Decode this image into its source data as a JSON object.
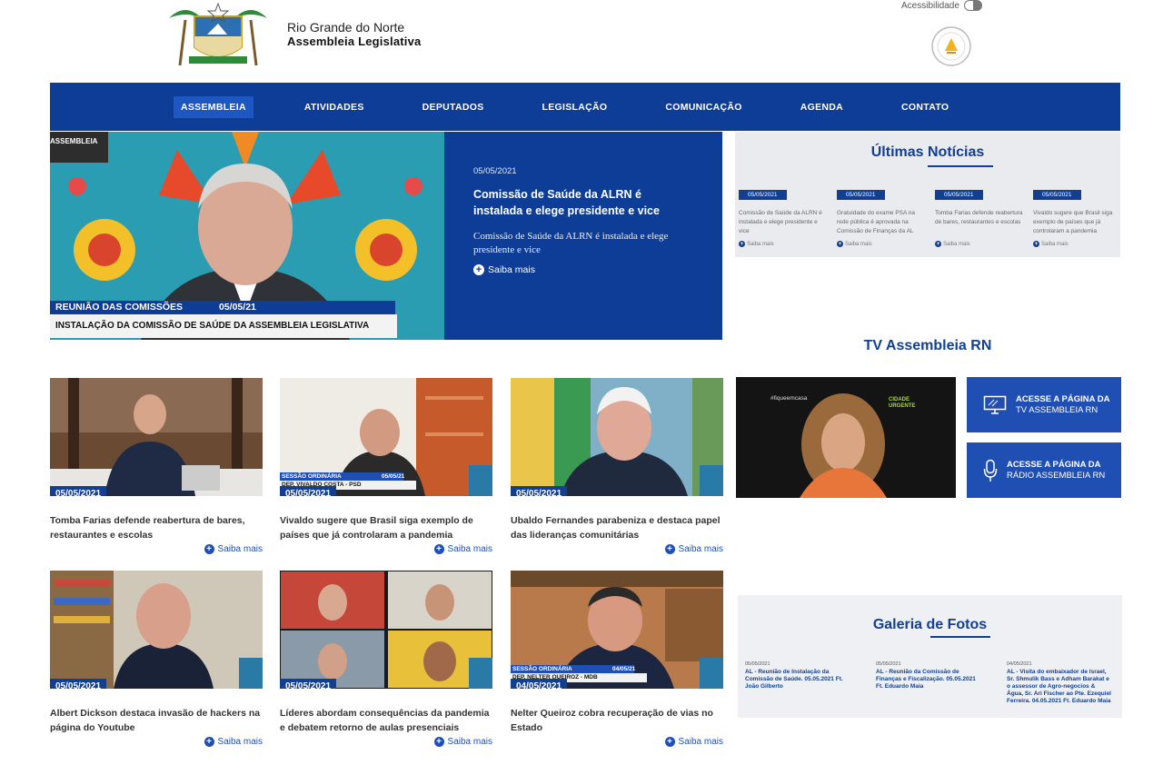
{
  "header": {
    "brand_line1": "Rio Grande do Norte",
    "brand_line2": "Assembleia Legislativa",
    "accessibility_label": "Acessibilidade"
  },
  "nav": {
    "items": [
      "ASSEMBLEIA",
      "ATIVIDADES",
      "DEPUTADOS",
      "LEGISLAÇÃO",
      "COMUNICAÇÃO",
      "AGENDA",
      "CONTATO"
    ],
    "active": "ASSEMBLEIA"
  },
  "hero": {
    "tag": "ASSEMBLEIA",
    "lower_third_label": "REUNIÃO DAS COMISSÕES",
    "lower_third_date": "05/05/21",
    "lower_third_title": "INSTALAÇÃO DA COMISSÃO DE SAÚDE DA ASSEMBLEIA LEGISLATIVA",
    "date": "05/05/2021",
    "title": "Comissão de Saúde da ALRN é instalada e elege presidente e vice",
    "summary": "Comissão de Saúde da ALRN é instalada e elege presidente e vice",
    "more": "Saiba mais"
  },
  "latest": {
    "heading": "Últimas Notícias",
    "items": [
      {
        "date": "05/05/2021",
        "title": "Comissão de Saúde da ALRN é instalada e elege presidente e vice",
        "more": "Saiba mais"
      },
      {
        "date": "05/05/2021",
        "title": "Gratuidade do exame PSA na rede pública é aprovada na Comissão de Finanças da AL",
        "more": "Saiba mais"
      },
      {
        "date": "05/05/2021",
        "title": "Tomba Farias defende reabertura de bares, restaurantes e escolas",
        "more": "Saiba mais"
      },
      {
        "date": "05/05/2021",
        "title": "Vivaldo sugere que Brasil siga exemplo de países que já controlaram a pandemia",
        "more": "Saiba mais"
      }
    ]
  },
  "tv": {
    "heading": "TV Assembleia RN",
    "video_hashtag": "#fiqueemcasa",
    "video_badge": "CIDADE URGENTE",
    "button_tv_line1": "ACESSE A PÁGINA DA",
    "button_tv_line2": "TV ASSEMBLEIA RN",
    "button_radio_line1": "ACESSE A PÁGINA DA",
    "button_radio_line2": "RÁDIO ASSEMBLEIA RN"
  },
  "news": [
    {
      "date": "05/05/2021",
      "title": "Tomba Farias defende reabertura de bares, restaurantes e escolas",
      "more": "Saiba mais"
    },
    {
      "date": "05/05/2021",
      "title": "Vivaldo sugere que Brasil siga exemplo de países que já controlaram a pandemia",
      "more": "Saiba mais",
      "overlay_label": "SESSÃO ORDINÁRIA",
      "overlay_date": "05/05/21",
      "overlay_name": "DEP. VIVALDO COSTA - PSD"
    },
    {
      "date": "05/05/2021",
      "title": "Ubaldo Fernandes parabeniza e destaca papel das lideranças comunitárias",
      "more": "Saiba mais"
    },
    {
      "date": "05/05/2021",
      "title": "Albert Dickson destaca invasão de hackers na página do Youtube",
      "more": "Saiba mais"
    },
    {
      "date": "05/05/2021",
      "title": "Líderes abordam consequências da pandemia e debatem retorno de aulas presenciais",
      "more": "Saiba mais"
    },
    {
      "date": "04/05/2021",
      "title": "Nelter Queiroz cobra recuperação de vias no Estado",
      "more": "Saiba mais",
      "overlay_label": "SESSÃO ORDINÁRIA",
      "overlay_date": "04/05/21",
      "overlay_name": "DEP. NELTER QUEIROZ - MDB"
    }
  ],
  "gallery": {
    "heading": "Galeria de Fotos",
    "items": [
      {
        "date": "05/05/2021",
        "title": "AL - Reunião de Instalação da Comissão de Saúde. 05.05.2021 Ft. João Gilberto"
      },
      {
        "date": "05/05/2021",
        "title": "AL - Reunião da Comissão de Finanças e Fiscalização. 05.05.2021 Ft. Eduardo Maia"
      },
      {
        "date": "04/05/2021",
        "title": "AL - Visita do embaixador de Israel, Sr. Shmulik Bass e Adham Barakat e o assessor de Agro-negocios & Água, Sr. Ari Fischer ao Pte. Ezequiel Ferreira. 04.05.2021 Ft. Eduardo Maia"
      }
    ]
  },
  "colors": {
    "primary": "#0d3d96",
    "accent": "#1f4fb3",
    "heading": "#123f8f"
  },
  "icons": [
    "crest-logo",
    "award-seal-icon",
    "accessibility-toggle-icon",
    "plus-circle-icon",
    "monitor-icon",
    "microphone-icon"
  ]
}
